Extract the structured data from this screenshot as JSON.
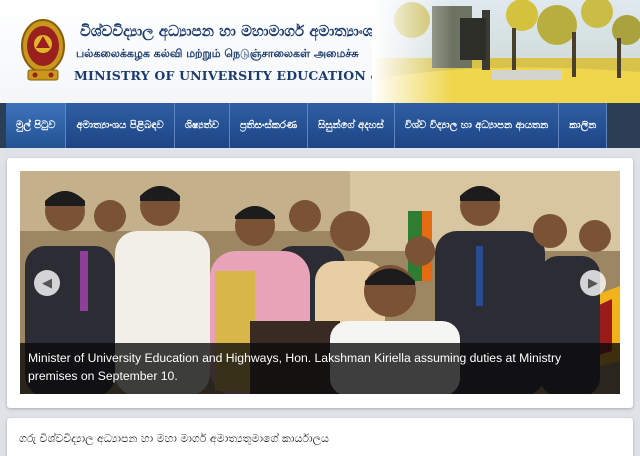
{
  "header": {
    "title_sinhala": "විශ්වවිද්‍යාල අධ්‍යාපන හා මහාමාර්ග අමාත්‍යාංශය",
    "title_tamil": "பல்கலைக்கழக கல்வி மற்றும் நெடுஞ்சாலைகள் அமைச்சு",
    "title_english": "MINISTRY OF UNIVERSITY EDUCATION & HIGHWAYS"
  },
  "nav": {
    "items": [
      {
        "label": "මුල් පිටුව",
        "active": true
      },
      {
        "label": "අමාත්‍යාංශය පිළිබඳව"
      },
      {
        "label": "ශිෂ්‍යත්ව"
      },
      {
        "label": "ප්‍රතිසංස්කරණ"
      },
      {
        "label": "සිසුන්ගේ අදහස්"
      },
      {
        "label": "විශ්ව විද්‍යාල හා අධ්‍යාපන ආයතන"
      },
      {
        "label": "කාලින"
      }
    ]
  },
  "slider": {
    "caption": "Minister of University Education and Highways, Hon. Lakshman Kiriella assuming duties at Ministry premises on September 10.",
    "prev_icon": "chevron-left-icon",
    "next_icon": "chevron-right-icon"
  },
  "office": {
    "title": "ගරු විශ්වවිද්‍යාල අධ්‍යාපන හා මහා මාර්ග අමාත්‍යතුමාගේ කාර්යාලය"
  },
  "colors": {
    "nav_blue": "#245394",
    "title_blue": "#1b3a6e",
    "page_bg": "#dfe3e8"
  }
}
